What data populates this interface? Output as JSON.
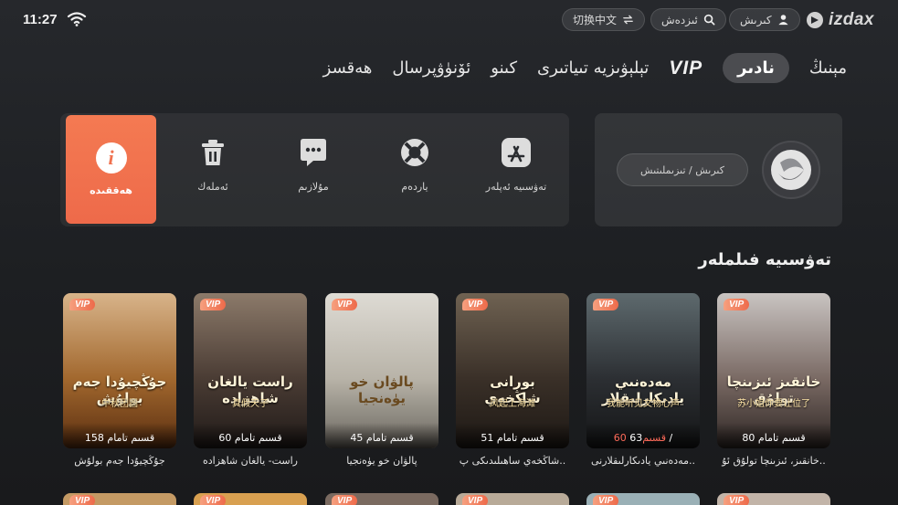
{
  "status": {
    "time": "11:27",
    "wifi_icon": "wifi-icon"
  },
  "header": {
    "lang_switch": "切换中文",
    "search": "ئىزدەش",
    "login": "كىرىش",
    "logo": "izdax"
  },
  "nav": {
    "items": [
      {
        "label": "مېنىڭ",
        "active": false
      },
      {
        "label": "نادىر",
        "active": true
      },
      {
        "label": "VIP",
        "active": false,
        "vip": true
      },
      {
        "label": "تېلېۋىزيە تىياتىرى",
        "active": false
      },
      {
        "label": "كىنو",
        "active": false
      },
      {
        "label": "ئۆنۈۋپرسال",
        "active": false
      },
      {
        "label": "ھەقسز",
        "active": false
      }
    ]
  },
  "actions": {
    "info": "ھەققىدە",
    "delete": "ئەملەك",
    "message": "مۇلازىم",
    "help": "ياردەم",
    "recommend": "تەۋسىيە ئەپلەر"
  },
  "login_panel": {
    "button": "كىرىش / تىزىملىتىش"
  },
  "section": {
    "title": "تەۋسىيە فىلملەر"
  },
  "cards": [
    {
      "title": "خانقىز، ئىزىنچا تولۇق ئۇ..",
      "episodes": "80 قسىم تامام",
      "poster_title": "خانقىز ئىزىنچا تولۇق",
      "poster_sub": "苏小姐你要让位了",
      "colors": [
        "#c9c4c2",
        "#7a6a64",
        "#2e2624"
      ]
    },
    {
      "title": "مەدەنىي يادىكارلىقلارنى..",
      "episodes_a": "63 / ",
      "episodes_b": "60 قسىم",
      "poster_title": "مەدەنىي يادىكارلىقلار",
      "poster_sub": "我能听见文物心声",
      "colors": [
        "#5e6a6e",
        "#2c2f33",
        "#141516"
      ]
    },
    {
      "title": "شاڭخەي ساھىلىدىكى پ..",
      "episodes": "51 قسىم تامام",
      "poster_title": "بورانى شاڭخەي",
      "poster_sub": "风起上海滩",
      "colors": [
        "#6f6252",
        "#3a3028",
        "#1d1814"
      ]
    },
    {
      "title": "پالۋان خو يۈەنجيا",
      "episodes": "45 قسىم تامام",
      "poster_title": "پالۋان خو يۈەنجيا",
      "poster_sub": "",
      "colors": [
        "#dedbd4",
        "#b8b3a8",
        "#6a665f"
      ]
    },
    {
      "title": "راست- يالغان شاھزادە",
      "episodes": "60 قسىم تامام",
      "poster_title": "راست يالغان شاھزادە",
      "poster_sub": "真假天子",
      "colors": [
        "#8c7a6a",
        "#4a3c34",
        "#201a18"
      ]
    },
    {
      "title": "جۇڭچيۇدا جەم بولۇش",
      "episodes": "158 قسىم تامام",
      "poster_title": "جۇڭچيۇدا جەم بولۇش",
      "poster_sub": "中秋团圆",
      "colors": [
        "#d8b48a",
        "#a2682e",
        "#5a2e10"
      ]
    }
  ],
  "row2_colors": [
    "#c49a64",
    "#d8a050",
    "#7a6a60",
    "#b8aa98",
    "#9ab0b6",
    "#c2b4a8"
  ]
}
